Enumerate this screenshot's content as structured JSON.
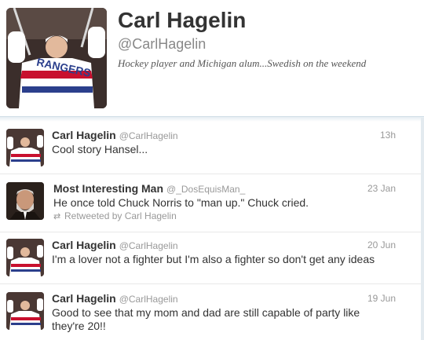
{
  "profile": {
    "name": "Carl Hagelin",
    "handle": "@CarlHagelin",
    "bio": "Hockey player and Michigan alum...Swedish on the weekend"
  },
  "tweets": [
    {
      "name": "Carl Hagelin",
      "handle": "@CarlHagelin",
      "time": "13h",
      "text": "Cool story Hansel..."
    },
    {
      "name": "Most Interesting Man",
      "handle": "@_DosEquisMan_",
      "time": "23 Jan",
      "text": "He once told Chuck Norris to \"man up.\" Chuck cried.",
      "retweet": "Retweeted by Carl Hagelin"
    },
    {
      "name": "Carl Hagelin",
      "handle": "@CarlHagelin",
      "time": "20 Jun",
      "text": "I'm a lover not a fighter but I'm also a fighter so don't get any ideas"
    },
    {
      "name": "Carl Hagelin",
      "handle": "@CarlHagelin",
      "time": "19 Jun",
      "text": "Good to see that my mom and dad are still capable of party like they're 20!!"
    }
  ],
  "icons": {
    "retweet": "retweet-icon",
    "jersey_avatar": "hockey-player-avatar",
    "man_avatar": "bearded-man-avatar"
  },
  "colors": {
    "jersey_blue": "#2b3f8c",
    "jersey_red": "#c8102e",
    "text": "#333333",
    "muted": "#999999"
  }
}
